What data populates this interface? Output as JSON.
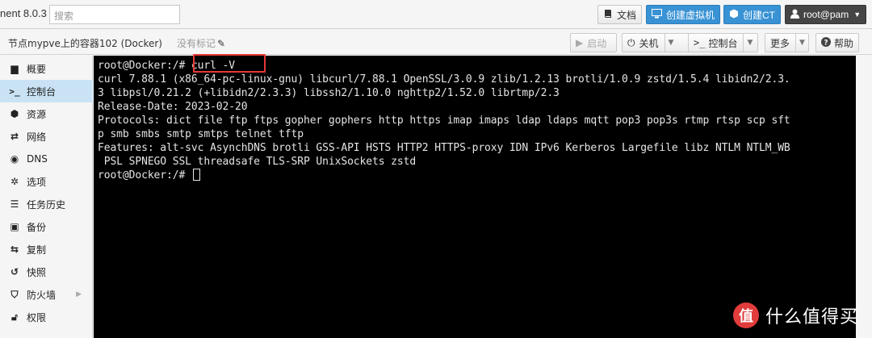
{
  "app": {
    "title": "nent 8.0.3"
  },
  "search": {
    "placeholder": "搜索"
  },
  "toolbar": {
    "docs": "文档",
    "create_vm": "创建虚拟机",
    "create_ct": "创建CT",
    "user": "root@pam"
  },
  "header": {
    "title": "节点mypve上的容器102 (Docker)",
    "no_tags": "没有标记",
    "start": "启动",
    "shutdown": "关机",
    "console": "控制台",
    "more": "更多",
    "help": "帮助"
  },
  "sidebar": {
    "items": [
      {
        "label": "概要",
        "icon": "book-icon"
      },
      {
        "label": "控制台",
        "icon": "terminal-icon"
      },
      {
        "label": "资源",
        "icon": "cube-icon"
      },
      {
        "label": "网络",
        "icon": "exchange-icon"
      },
      {
        "label": "DNS",
        "icon": "globe-icon"
      },
      {
        "label": "选项",
        "icon": "gear-icon"
      },
      {
        "label": "任务历史",
        "icon": "list-icon"
      },
      {
        "label": "备份",
        "icon": "floppy-icon"
      },
      {
        "label": "复制",
        "icon": "retweet-icon"
      },
      {
        "label": "快照",
        "icon": "history-icon"
      },
      {
        "label": "防火墙",
        "icon": "shield-icon"
      },
      {
        "label": "权限",
        "icon": "unlock-icon"
      }
    ],
    "active_index": 1
  },
  "terminal": {
    "prompt1": "root@Docker:/# ",
    "command": "curl -V",
    "lines": [
      "curl 7.88.1 (x86_64-pc-linux-gnu) libcurl/7.88.1 OpenSSL/3.0.9 zlib/1.2.13 brotli/1.0.9 zstd/1.5.4 libidn2/2.3.",
      "3 libpsl/0.21.2 (+libidn2/2.3.3) libssh2/1.10.0 nghttp2/1.52.0 librtmp/2.3",
      "Release-Date: 2023-02-20",
      "Protocols: dict file ftp ftps gopher gophers http https imap imaps ldap ldaps mqtt pop3 pop3s rtmp rtsp scp sft",
      "p smb smbs smtp smtps telnet tftp",
      "Features: alt-svc AsynchDNS brotli GSS-API HSTS HTTP2 HTTPS-proxy IDN IPv6 Kerberos Largefile libz NTLM NTLM_WB",
      " PSL SPNEGO SSL threadsafe TLS-SRP UnixSockets zstd"
    ],
    "prompt2": "root@Docker:/# "
  },
  "watermark": {
    "logo": "值",
    "text": "什么值得买"
  },
  "colors": {
    "accent": "#3892d4",
    "highlight_box": "#e53935",
    "active_item": "#c9e3f5"
  }
}
